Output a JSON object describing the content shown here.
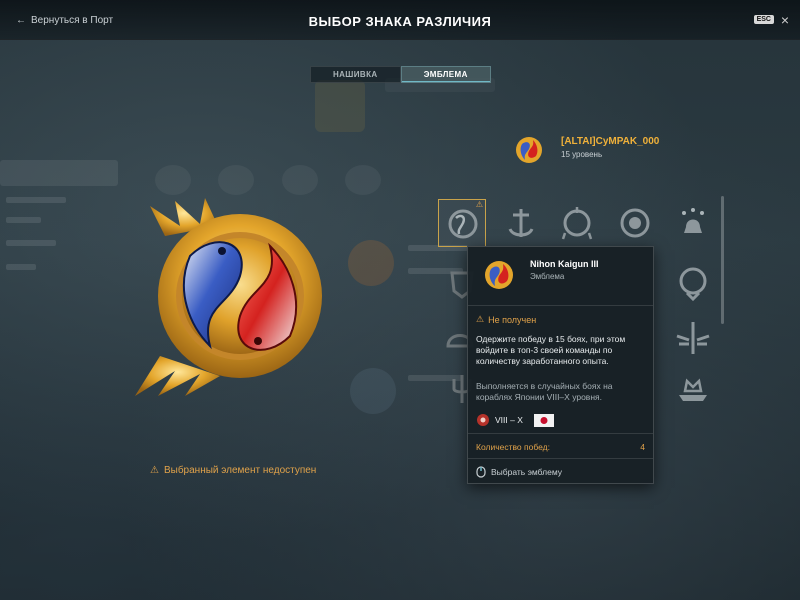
{
  "header": {
    "back_label": "Вернуться в Порт",
    "title": "ВЫБОР ЗНАКА РАЗЛИЧИЯ",
    "esc_label": "ESC",
    "close_symbol": "×"
  },
  "tabs": [
    {
      "label": "НАШИВКА",
      "active": false
    },
    {
      "label": "ЭМБЛЕМА",
      "active": true
    }
  ],
  "preview": {
    "emblem_icon": "koi-fish-emblem-icon",
    "unavailable_text": "Выбранный элемент недоступен"
  },
  "player": {
    "name": "[ALTAI]CyMPAK_000",
    "level": "15 уровень"
  },
  "grid": {
    "selected_index": 0,
    "items": [
      {
        "icon": "koi-emblem-locked-icon",
        "warning": true
      },
      {
        "icon": "anchor-emblem-icon",
        "warning": false
      },
      {
        "icon": "wreath-emblem-icon",
        "warning": false
      },
      {
        "icon": "spiral-emblem-icon",
        "warning": false
      },
      {
        "icon": "stars-bell-emblem-icon",
        "warning": false
      },
      {
        "icon": "round-emblem-icon",
        "warning": false
      },
      {
        "icon": "shield-emblem-icon",
        "warning": false
      },
      {
        "icon": "sword-wings-emblem-icon",
        "warning": false
      },
      {
        "icon": "helmet-emblem-icon",
        "warning": false
      },
      {
        "icon": "trident-emblem-icon",
        "warning": false
      },
      {
        "icon": "crown-ship-emblem-icon",
        "warning": false
      }
    ]
  },
  "tooltip": {
    "name": "Nihon Kaigun III",
    "type": "Эмблема",
    "status": "Не получен",
    "description": "Одержите победу в 15 боях, при этом войдите в топ-3 своей команды по количеству заработанного опыта.",
    "condition": "Выполняется в случайных боях на кораблях Японии VIII–X уровня.",
    "tier_range": "VIII – X",
    "nation": "japan-flag-icon",
    "count_label": "Количество побед:",
    "count_value": "4",
    "action_label": "Выбрать эмблему"
  },
  "colors": {
    "accent_gold": "#f0b13a",
    "warning": "#e0a24a",
    "tab_active": "#6fb8c6"
  }
}
